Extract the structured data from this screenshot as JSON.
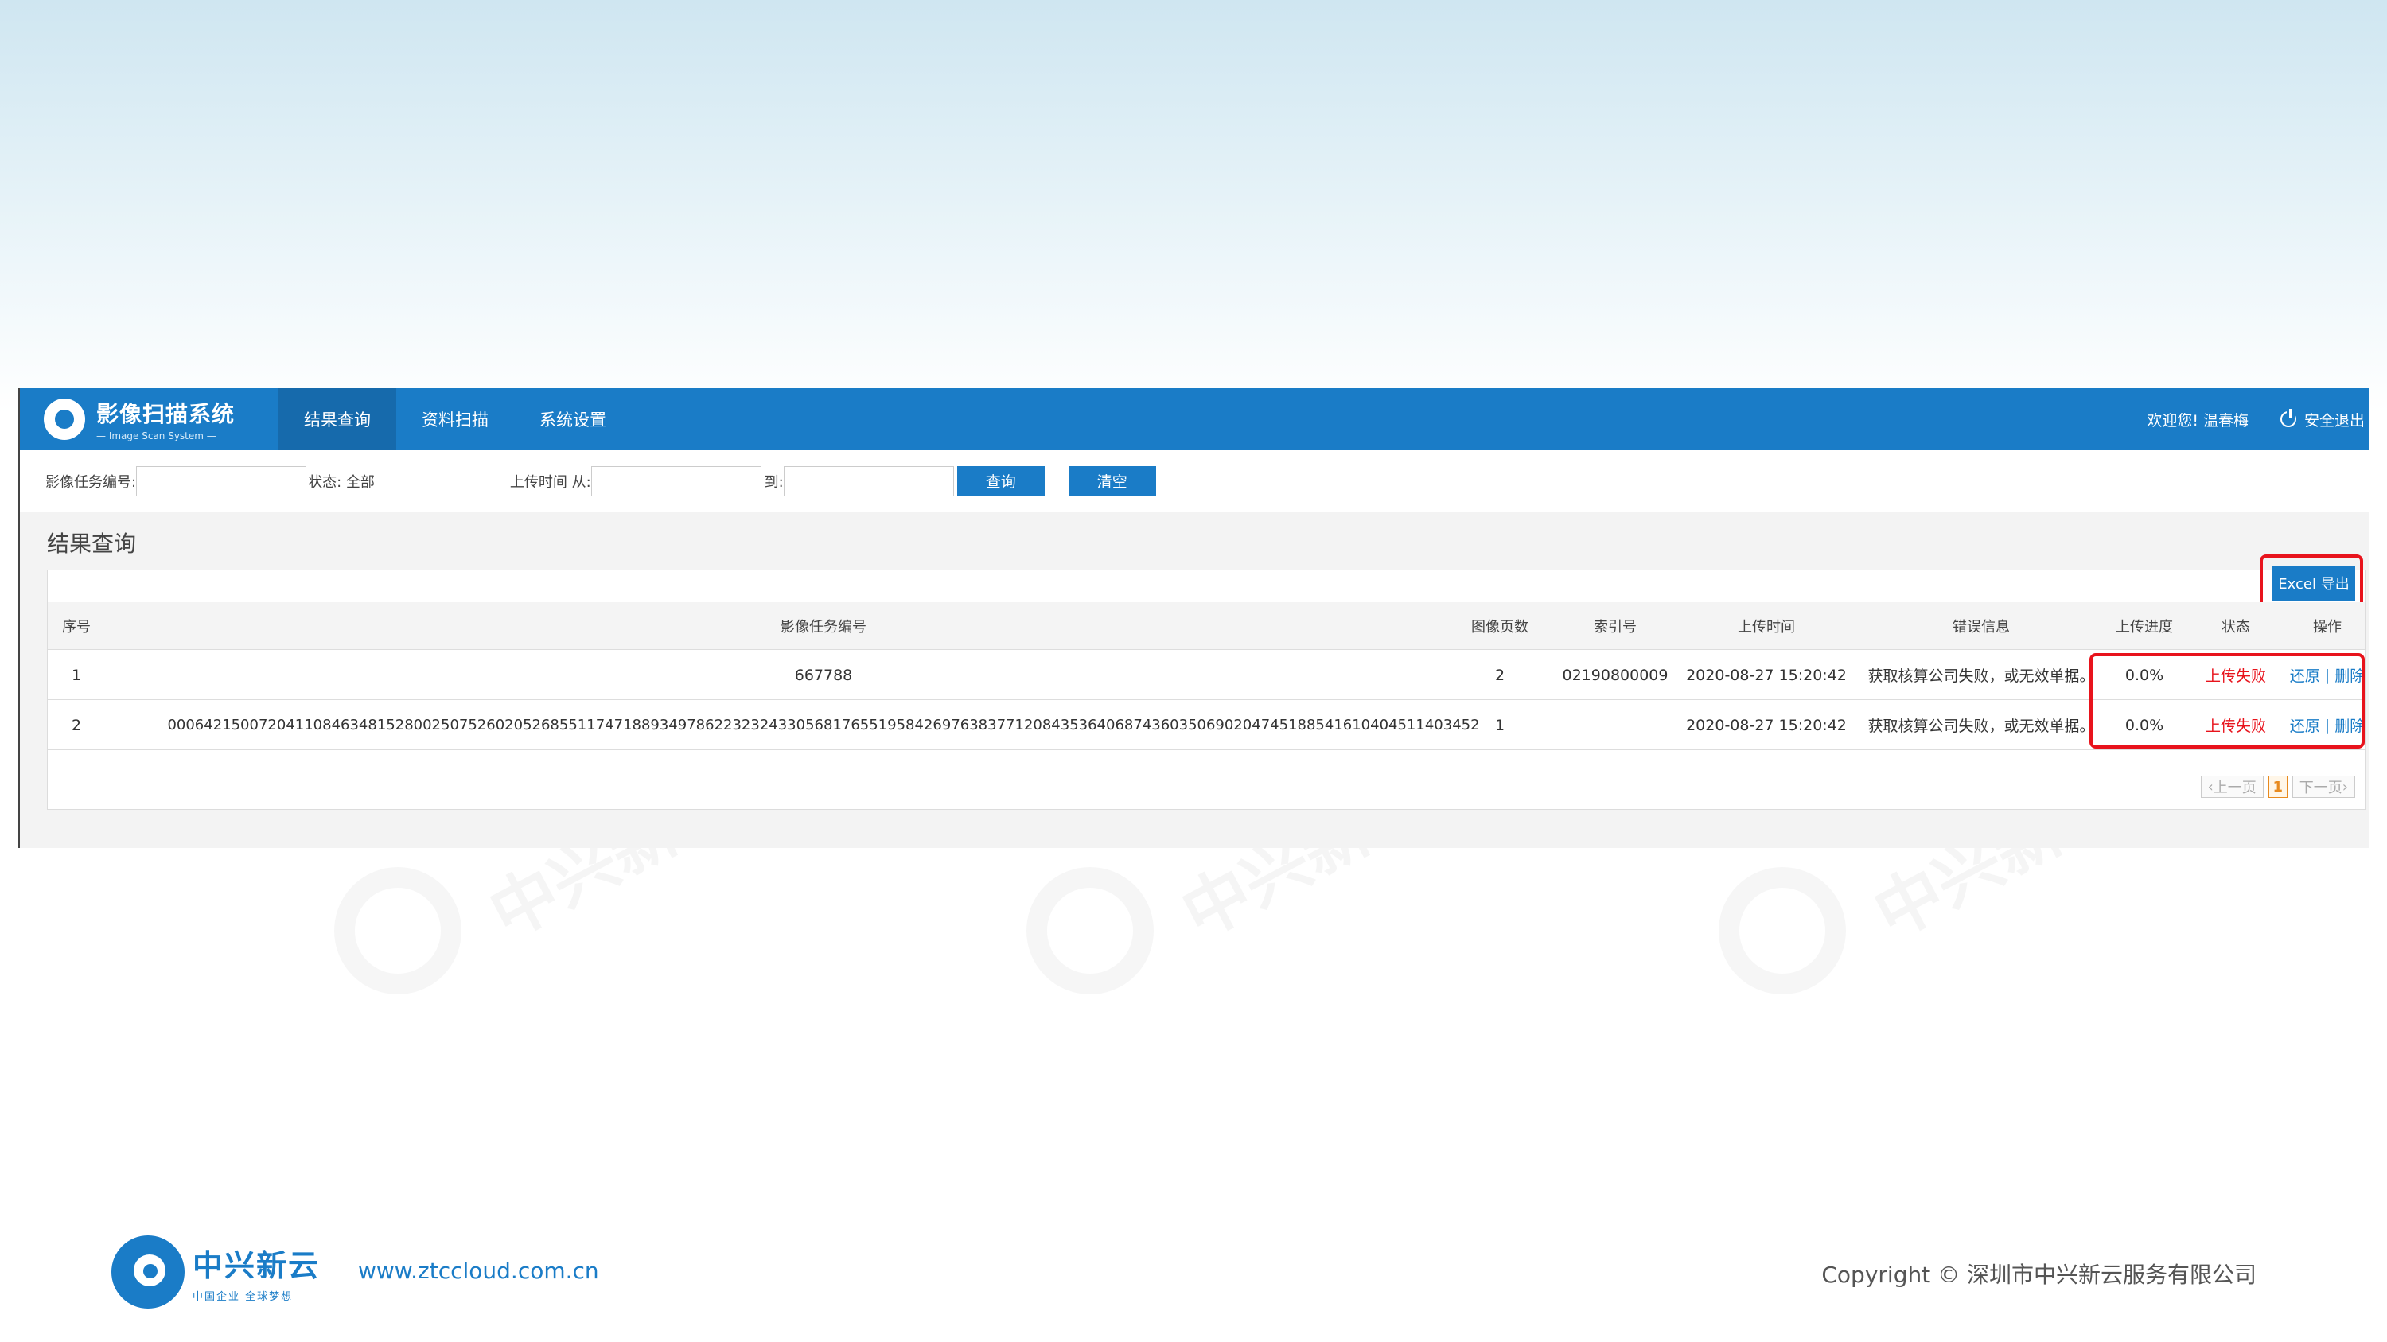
{
  "app": {
    "title": "影像扫描系统",
    "subtitle": "— Image Scan System —",
    "nav": [
      {
        "label": "结果查询"
      },
      {
        "label": "资料扫描"
      },
      {
        "label": "系统设置"
      }
    ],
    "welcome": "欢迎您! 温春梅",
    "logout": "安全退出"
  },
  "filter": {
    "task_label": "影像任务编号:",
    "task_value": "",
    "status_label": "状态: 全部",
    "time_label": "上传时间 从:",
    "time_from": "",
    "to_label": "到:",
    "time_to": "",
    "query_btn": "查询",
    "clear_btn": "清空"
  },
  "page": {
    "title": "结果查询",
    "excel_btn": "Excel 导出"
  },
  "table": {
    "headers": {
      "seq": "序号",
      "task": "影像任务编号",
      "pages": "图像页数",
      "index": "索引号",
      "time": "上传时间",
      "error": "错误信息",
      "progress": "上传进度",
      "status": "状态",
      "op": "操作"
    },
    "rows": [
      {
        "seq": "1",
        "task": "667788",
        "pages": "2",
        "index": "02190800009",
        "time": "2020-08-27 15:20:42",
        "error": "获取核算公司失败，或无效单据。",
        "progress": "0.0%",
        "status": "上传失败",
        "restore": "还原",
        "delete": "删除"
      },
      {
        "seq": "2",
        "task": "000642150072041108463481528002507526020526855117471889349786223232433056817655195842697638377120843536406874360350690204745188541610404511403452",
        "pages": "1",
        "index": "",
        "time": "2020-08-27 15:20:42",
        "error": "获取核算公司失败，或无效单据。",
        "progress": "0.0%",
        "status": "上传失败",
        "restore": "还原",
        "delete": "删除"
      }
    ]
  },
  "pager": {
    "prev": "上一页",
    "current": "1",
    "next": "下一页"
  },
  "footer": {
    "brand": "中兴新云",
    "tagline": "中国企业 全球梦想",
    "url": "www.ztccloud.com.cn",
    "copyright": "Copyright © 深圳市中兴新云服务有限公司"
  },
  "colors": {
    "primary": "#1a7cc7",
    "highlight": "#e8131c",
    "fail": "#e8131c"
  }
}
